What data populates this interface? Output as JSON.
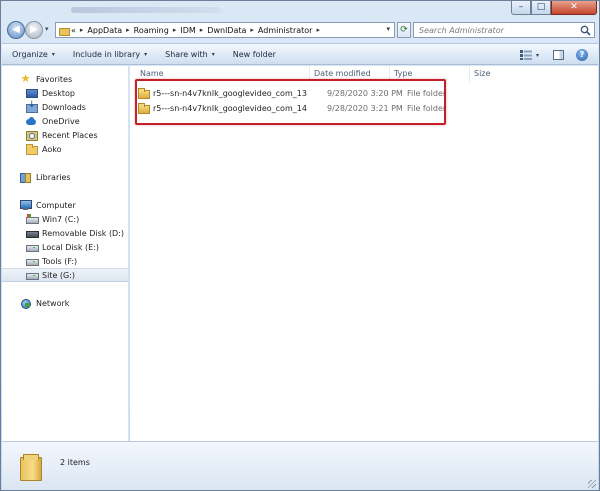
{
  "caption": {
    "minimize": "–",
    "maximize": "□",
    "close": "✕"
  },
  "nav": {
    "back": "◀",
    "forward": "▶"
  },
  "address": {
    "lead": "«",
    "crumbs": [
      "AppData",
      "Roaming",
      "IDM",
      "DwnlData",
      "Administrator"
    ],
    "separator": "▸"
  },
  "search": {
    "placeholder": "Search Administrator"
  },
  "toolbar": {
    "organize": "Organize",
    "include_in_library": "Include in library",
    "share_with": "Share with",
    "new_folder": "New folder",
    "caret": "▾",
    "help": "?"
  },
  "navpane": {
    "favorites": "Favorites",
    "desktop": "Desktop",
    "downloads": "Downloads",
    "onedrive": "OneDrive",
    "recent_places": "Recent Places",
    "aoko": "Aoko",
    "libraries": "Libraries",
    "computer": "Computer",
    "win7": "Win7 (C:)",
    "removable": "Removable Disk (D:)",
    "local_disk": "Local Disk (E:)",
    "tools": "Tools (F:)",
    "site": "Site (G:)",
    "network": "Network"
  },
  "columns": {
    "name": "Name",
    "date_modified": "Date modified",
    "type": "Type",
    "size": "Size"
  },
  "files": [
    {
      "name": "r5---sn-n4v7knlk_googlevideo_com_13",
      "date": "9/28/2020 3:20 PM",
      "type": "File folder"
    },
    {
      "name": "r5---sn-n4v7knlk_googlevideo_com_14",
      "date": "9/28/2020 3:21 PM",
      "type": "File folder"
    }
  ],
  "details": {
    "items_count": "2 items"
  },
  "colors": {
    "highlight_border": "#c4202a",
    "folder": "#efcc6a"
  }
}
